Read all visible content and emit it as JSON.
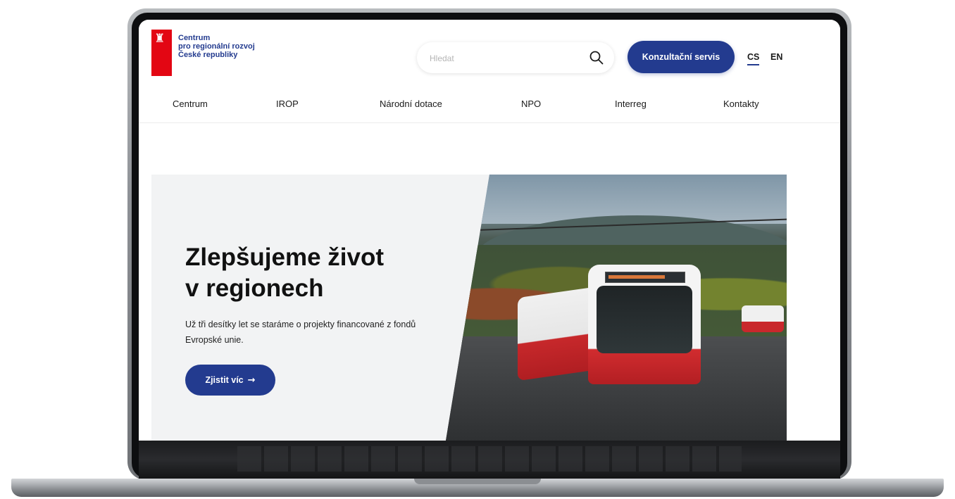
{
  "logo": {
    "emblem": "lion-emblem",
    "lines": [
      "Centrum",
      "pro regionální rozvoj",
      "České republiky"
    ]
  },
  "search": {
    "placeholder": "Hledat",
    "icon": "search-icon"
  },
  "header": {
    "consult_button": "Konzultační servis"
  },
  "languages": {
    "active": "CS",
    "other": "EN"
  },
  "nav": {
    "items": [
      "Centrum",
      "IROP",
      "Národní dotace",
      "NPO",
      "Interreg",
      "Kontakty"
    ]
  },
  "hero": {
    "title_line1": "Zlepšujeme život",
    "title_line2": "v regionech",
    "description": "Už tři desítky let se staráme o projekty financované z fondů Evropské unie.",
    "button_label": "Zjistit víc",
    "button_icon": "→",
    "image": "trolleybus-photo"
  },
  "colors": {
    "brand_blue": "#233b8f",
    "brand_red": "#e30613",
    "hero_bg": "#f2f3f4"
  }
}
